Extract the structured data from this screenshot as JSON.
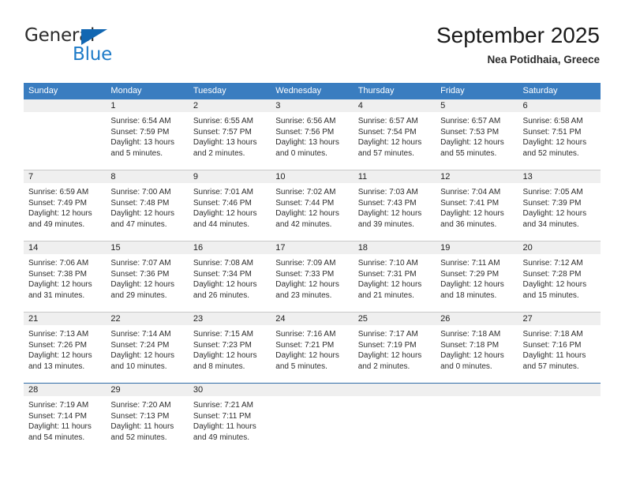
{
  "brand": {
    "name_part1": "General",
    "name_part2": "Blue",
    "triangle_icon": "triangle-icon",
    "accent_color": "#1e7bc8"
  },
  "header": {
    "title": "September 2025",
    "location": "Nea Potidhaia, Greece"
  },
  "theme": {
    "header_blue": "#3a7dc0",
    "band_gray": "#efefef",
    "row_divider": "#c9c9c9",
    "last_row_divider": "#2f6ca8"
  },
  "weekdays": [
    "Sunday",
    "Monday",
    "Tuesday",
    "Wednesday",
    "Thursday",
    "Friday",
    "Saturday"
  ],
  "labels": {
    "sunrise_prefix": "Sunrise:",
    "sunset_prefix": "Sunset:",
    "daylight_prefix": "Daylight:"
  },
  "weeks": [
    [
      {
        "day": "",
        "sunrise": "",
        "sunset": "",
        "daylight_line1": "",
        "daylight_line2": ""
      },
      {
        "day": "1",
        "sunrise": "Sunrise: 6:54 AM",
        "sunset": "Sunset: 7:59 PM",
        "daylight_line1": "Daylight: 13 hours",
        "daylight_line2": "and 5 minutes."
      },
      {
        "day": "2",
        "sunrise": "Sunrise: 6:55 AM",
        "sunset": "Sunset: 7:57 PM",
        "daylight_line1": "Daylight: 13 hours",
        "daylight_line2": "and 2 minutes."
      },
      {
        "day": "3",
        "sunrise": "Sunrise: 6:56 AM",
        "sunset": "Sunset: 7:56 PM",
        "daylight_line1": "Daylight: 13 hours",
        "daylight_line2": "and 0 minutes."
      },
      {
        "day": "4",
        "sunrise": "Sunrise: 6:57 AM",
        "sunset": "Sunset: 7:54 PM",
        "daylight_line1": "Daylight: 12 hours",
        "daylight_line2": "and 57 minutes."
      },
      {
        "day": "5",
        "sunrise": "Sunrise: 6:57 AM",
        "sunset": "Sunset: 7:53 PM",
        "daylight_line1": "Daylight: 12 hours",
        "daylight_line2": "and 55 minutes."
      },
      {
        "day": "6",
        "sunrise": "Sunrise: 6:58 AM",
        "sunset": "Sunset: 7:51 PM",
        "daylight_line1": "Daylight: 12 hours",
        "daylight_line2": "and 52 minutes."
      }
    ],
    [
      {
        "day": "7",
        "sunrise": "Sunrise: 6:59 AM",
        "sunset": "Sunset: 7:49 PM",
        "daylight_line1": "Daylight: 12 hours",
        "daylight_line2": "and 49 minutes."
      },
      {
        "day": "8",
        "sunrise": "Sunrise: 7:00 AM",
        "sunset": "Sunset: 7:48 PM",
        "daylight_line1": "Daylight: 12 hours",
        "daylight_line2": "and 47 minutes."
      },
      {
        "day": "9",
        "sunrise": "Sunrise: 7:01 AM",
        "sunset": "Sunset: 7:46 PM",
        "daylight_line1": "Daylight: 12 hours",
        "daylight_line2": "and 44 minutes."
      },
      {
        "day": "10",
        "sunrise": "Sunrise: 7:02 AM",
        "sunset": "Sunset: 7:44 PM",
        "daylight_line1": "Daylight: 12 hours",
        "daylight_line2": "and 42 minutes."
      },
      {
        "day": "11",
        "sunrise": "Sunrise: 7:03 AM",
        "sunset": "Sunset: 7:43 PM",
        "daylight_line1": "Daylight: 12 hours",
        "daylight_line2": "and 39 minutes."
      },
      {
        "day": "12",
        "sunrise": "Sunrise: 7:04 AM",
        "sunset": "Sunset: 7:41 PM",
        "daylight_line1": "Daylight: 12 hours",
        "daylight_line2": "and 36 minutes."
      },
      {
        "day": "13",
        "sunrise": "Sunrise: 7:05 AM",
        "sunset": "Sunset: 7:39 PM",
        "daylight_line1": "Daylight: 12 hours",
        "daylight_line2": "and 34 minutes."
      }
    ],
    [
      {
        "day": "14",
        "sunrise": "Sunrise: 7:06 AM",
        "sunset": "Sunset: 7:38 PM",
        "daylight_line1": "Daylight: 12 hours",
        "daylight_line2": "and 31 minutes."
      },
      {
        "day": "15",
        "sunrise": "Sunrise: 7:07 AM",
        "sunset": "Sunset: 7:36 PM",
        "daylight_line1": "Daylight: 12 hours",
        "daylight_line2": "and 29 minutes."
      },
      {
        "day": "16",
        "sunrise": "Sunrise: 7:08 AM",
        "sunset": "Sunset: 7:34 PM",
        "daylight_line1": "Daylight: 12 hours",
        "daylight_line2": "and 26 minutes."
      },
      {
        "day": "17",
        "sunrise": "Sunrise: 7:09 AM",
        "sunset": "Sunset: 7:33 PM",
        "daylight_line1": "Daylight: 12 hours",
        "daylight_line2": "and 23 minutes."
      },
      {
        "day": "18",
        "sunrise": "Sunrise: 7:10 AM",
        "sunset": "Sunset: 7:31 PM",
        "daylight_line1": "Daylight: 12 hours",
        "daylight_line2": "and 21 minutes."
      },
      {
        "day": "19",
        "sunrise": "Sunrise: 7:11 AM",
        "sunset": "Sunset: 7:29 PM",
        "daylight_line1": "Daylight: 12 hours",
        "daylight_line2": "and 18 minutes."
      },
      {
        "day": "20",
        "sunrise": "Sunrise: 7:12 AM",
        "sunset": "Sunset: 7:28 PM",
        "daylight_line1": "Daylight: 12 hours",
        "daylight_line2": "and 15 minutes."
      }
    ],
    [
      {
        "day": "21",
        "sunrise": "Sunrise: 7:13 AM",
        "sunset": "Sunset: 7:26 PM",
        "daylight_line1": "Daylight: 12 hours",
        "daylight_line2": "and 13 minutes."
      },
      {
        "day": "22",
        "sunrise": "Sunrise: 7:14 AM",
        "sunset": "Sunset: 7:24 PM",
        "daylight_line1": "Daylight: 12 hours",
        "daylight_line2": "and 10 minutes."
      },
      {
        "day": "23",
        "sunrise": "Sunrise: 7:15 AM",
        "sunset": "Sunset: 7:23 PM",
        "daylight_line1": "Daylight: 12 hours",
        "daylight_line2": "and 8 minutes."
      },
      {
        "day": "24",
        "sunrise": "Sunrise: 7:16 AM",
        "sunset": "Sunset: 7:21 PM",
        "daylight_line1": "Daylight: 12 hours",
        "daylight_line2": "and 5 minutes."
      },
      {
        "day": "25",
        "sunrise": "Sunrise: 7:17 AM",
        "sunset": "Sunset: 7:19 PM",
        "daylight_line1": "Daylight: 12 hours",
        "daylight_line2": "and 2 minutes."
      },
      {
        "day": "26",
        "sunrise": "Sunrise: 7:18 AM",
        "sunset": "Sunset: 7:18 PM",
        "daylight_line1": "Daylight: 12 hours",
        "daylight_line2": "and 0 minutes."
      },
      {
        "day": "27",
        "sunrise": "Sunrise: 7:18 AM",
        "sunset": "Sunset: 7:16 PM",
        "daylight_line1": "Daylight: 11 hours",
        "daylight_line2": "and 57 minutes."
      }
    ],
    [
      {
        "day": "28",
        "sunrise": "Sunrise: 7:19 AM",
        "sunset": "Sunset: 7:14 PM",
        "daylight_line1": "Daylight: 11 hours",
        "daylight_line2": "and 54 minutes."
      },
      {
        "day": "29",
        "sunrise": "Sunrise: 7:20 AM",
        "sunset": "Sunset: 7:13 PM",
        "daylight_line1": "Daylight: 11 hours",
        "daylight_line2": "and 52 minutes."
      },
      {
        "day": "30",
        "sunrise": "Sunrise: 7:21 AM",
        "sunset": "Sunset: 7:11 PM",
        "daylight_line1": "Daylight: 11 hours",
        "daylight_line2": "and 49 minutes."
      },
      {
        "day": "",
        "sunrise": "",
        "sunset": "",
        "daylight_line1": "",
        "daylight_line2": ""
      },
      {
        "day": "",
        "sunrise": "",
        "sunset": "",
        "daylight_line1": "",
        "daylight_line2": ""
      },
      {
        "day": "",
        "sunrise": "",
        "sunset": "",
        "daylight_line1": "",
        "daylight_line2": ""
      },
      {
        "day": "",
        "sunrise": "",
        "sunset": "",
        "daylight_line1": "",
        "daylight_line2": ""
      }
    ]
  ]
}
